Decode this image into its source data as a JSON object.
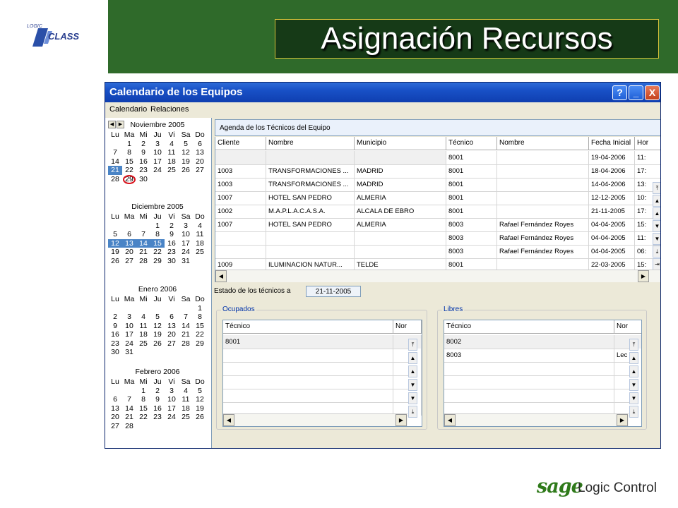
{
  "slide": {
    "title": "Asignación Recursos"
  },
  "logos": {
    "top_left_small": "LOGIC",
    "top_left_big": "CLASS",
    "bottom_sage": "sage",
    "bottom_rest": "Logic Control"
  },
  "window": {
    "title": "Calendario de los Equipos",
    "buttons": {
      "help": "?",
      "minimize": "_",
      "close": "X"
    },
    "menu": [
      "Calendario",
      "Relaciones"
    ]
  },
  "calendar": {
    "weekdays": [
      "Lu",
      "Ma",
      "Mi",
      "Ju",
      "Vi",
      "Sa",
      "Do"
    ],
    "months": [
      {
        "name": "Noviembre 2005",
        "weeks": [
          [
            "",
            "1",
            "2",
            "3",
            "4",
            "5",
            "6"
          ],
          [
            "7",
            "8",
            "9",
            "10",
            "11",
            "12",
            "13"
          ],
          [
            "14",
            "15",
            "16",
            "17",
            "18",
            "19",
            "20"
          ],
          [
            "21",
            "22",
            "23",
            "24",
            "25",
            "26",
            "27"
          ],
          [
            "28",
            "29",
            "30",
            "",
            "",
            "",
            ""
          ]
        ],
        "selected": [
          "21"
        ],
        "circled": "29"
      },
      {
        "name": "Diciembre 2005",
        "weeks": [
          [
            "",
            "",
            "",
            "1",
            "2",
            "3",
            "4"
          ],
          [
            "5",
            "6",
            "7",
            "8",
            "9",
            "10",
            "11"
          ],
          [
            "12",
            "13",
            "14",
            "15",
            "16",
            "17",
            "18"
          ],
          [
            "19",
            "20",
            "21",
            "22",
            "23",
            "24",
            "25"
          ],
          [
            "26",
            "27",
            "28",
            "29",
            "30",
            "31",
            ""
          ]
        ],
        "selected": [
          "12",
          "13",
          "14",
          "15"
        ]
      },
      {
        "name": "Enero 2006",
        "weeks": [
          [
            "",
            "",
            "",
            "",
            "",
            "",
            "1"
          ],
          [
            "2",
            "3",
            "4",
            "5",
            "6",
            "7",
            "8"
          ],
          [
            "9",
            "10",
            "11",
            "12",
            "13",
            "14",
            "15"
          ],
          [
            "16",
            "17",
            "18",
            "19",
            "20",
            "21",
            "22"
          ],
          [
            "23",
            "24",
            "25",
            "26",
            "27",
            "28",
            "29"
          ],
          [
            "30",
            "31",
            "",
            "",
            "",
            "",
            ""
          ]
        ],
        "selected": []
      },
      {
        "name": "Febrero 2006",
        "weeks": [
          [
            "",
            "",
            "1",
            "2",
            "3",
            "4",
            "5"
          ],
          [
            "6",
            "7",
            "8",
            "9",
            "10",
            "11",
            "12"
          ],
          [
            "13",
            "14",
            "15",
            "16",
            "17",
            "18",
            "19"
          ],
          [
            "20",
            "21",
            "22",
            "23",
            "24",
            "25",
            "26"
          ],
          [
            "27",
            "28",
            "",
            "",
            "",
            "",
            ""
          ]
        ],
        "selected": []
      }
    ]
  },
  "agenda": {
    "title": "Agenda de los Técnicos del Equipo",
    "columns": [
      "Cliente",
      "Nombre",
      "Municipio",
      "Técnico",
      "Nombre",
      "Fecha Inicial",
      "Hor"
    ],
    "rows": [
      [
        "",
        "",
        "",
        "8001",
        "",
        "19-04-2006",
        "11:"
      ],
      [
        "1003",
        "TRANSFORMACIONES ...",
        "MADRID",
        "8001",
        "",
        "18-04-2006",
        "17:"
      ],
      [
        "1003",
        "TRANSFORMACIONES ...",
        "MADRID",
        "8001",
        "",
        "14-04-2006",
        "13:"
      ],
      [
        "1007",
        "HOTEL SAN PEDRO",
        "ALMERIA",
        "8001",
        "",
        "12-12-2005",
        "10:"
      ],
      [
        "1002",
        "M.A.P.L.A.C.A.S.A.",
        "ALCALA DE EBRO",
        "8001",
        "",
        "21-11-2005",
        "17:"
      ],
      [
        "1007",
        "HOTEL SAN PEDRO",
        "ALMERIA",
        "8003",
        "Rafael Fernández Royes",
        "04-04-2005",
        "15:"
      ],
      [
        "",
        "",
        "",
        "8003",
        "Rafael Fernández Royes",
        "04-04-2005",
        "11:"
      ],
      [
        "",
        "",
        "",
        "8003",
        "Rafael Fernández Royes",
        "04-04-2005",
        "06:"
      ],
      [
        "1009",
        "ILUMINACION NATUR...",
        "TELDE",
        "8001",
        "",
        "22-03-2005",
        "15:"
      ]
    ]
  },
  "estado": {
    "label": "Estado de los técnicos a",
    "date": "21-11-2005"
  },
  "ocupados": {
    "label": "Ocupados",
    "columns": [
      "Técnico",
      "Nor"
    ],
    "rows": [
      [
        "8001",
        ""
      ]
    ]
  },
  "libres": {
    "label": "Libres",
    "columns": [
      "Técnico",
      "Nor"
    ],
    "rows": [
      [
        "8002",
        ""
      ],
      [
        "8003",
        "Lec"
      ]
    ]
  }
}
